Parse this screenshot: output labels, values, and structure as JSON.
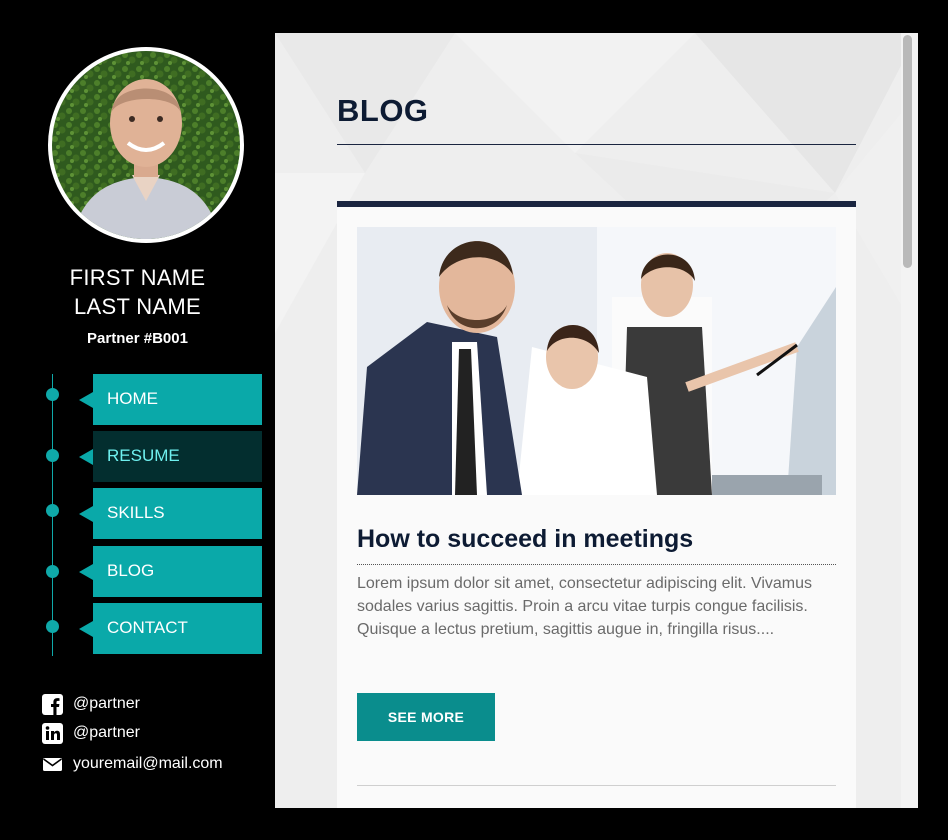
{
  "profile": {
    "first_name": "FIRST NAME",
    "last_name": "LAST NAME",
    "partner_id": "Partner #B001"
  },
  "nav": {
    "items": [
      {
        "label": "HOME",
        "active": false
      },
      {
        "label": "RESUME",
        "active": true
      },
      {
        "label": "SKILLS",
        "active": false
      },
      {
        "label": "BLOG",
        "active": false
      },
      {
        "label": "CONTACT",
        "active": false
      }
    ]
  },
  "social": {
    "facebook": {
      "icon": "facebook-icon",
      "text": "@partner"
    },
    "linkedin": {
      "icon": "linkedin-icon",
      "text": "@partner"
    },
    "email": {
      "icon": "envelope-icon",
      "text": "youremail@mail.com"
    }
  },
  "main": {
    "page_title": "BLOG",
    "post": {
      "title": "How to succeed in meetings",
      "excerpt": "Lorem ipsum dolor sit amet, consectetur adipiscing elit. Vivamus sodales varius sagittis. Proin a arcu vitae turpis congue facilisis. Quisque a lectus pretium, sagittis augue in, fringilla risus....",
      "button_label": "SEE MORE"
    }
  },
  "colors": {
    "accent": "#0aa9a9",
    "active_nav": "#032e2f",
    "button": "#0a8d8d",
    "title": "#0d1b33"
  }
}
